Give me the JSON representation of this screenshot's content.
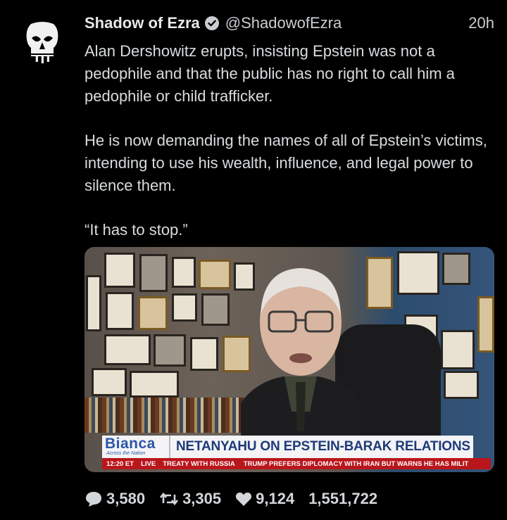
{
  "tweet": {
    "display_name": "Shadow of Ezra",
    "handle": "@ShadowofEzra",
    "time": "20h",
    "paragraphs": [
      "Alan Dershowitz erupts, insisting Epstein was not a pedophile and that the public has no right to call him a pedophile or child trafficker.",
      "He is now demanding the names of all of Epstein’s victims, intending to use his wealth, influence, and legal power to silence them.",
      "“It has to stop.”"
    ]
  },
  "video": {
    "logo_text": "Bianca",
    "logo_subtitle": "Across the Nation",
    "headline": "NETANYAHU ON EPSTEIN-BARAK RELATIONS",
    "ticker_time": "12:20 ET",
    "ticker_live": "LIVE",
    "ticker_item_1": "TREATY WITH RUSSIA",
    "ticker_item_2": "TRUMP PREFERS DIPLOMACY WITH IRAN BUT WARNS HE HAS MILIT"
  },
  "stats": {
    "replies": "3,580",
    "retweets": "3,305",
    "likes": "9,124",
    "views": "1,551,722"
  },
  "icons": {
    "avatar": "punisher-skull-icon",
    "verified": "verified-badge-icon",
    "reply": "comment-icon",
    "retweet": "retweet-icon",
    "like": "heart-icon"
  },
  "colors": {
    "background": "#000000",
    "verified": "#c9cdd1",
    "headline": "#1e3a78",
    "ticker": "#b9161c"
  }
}
